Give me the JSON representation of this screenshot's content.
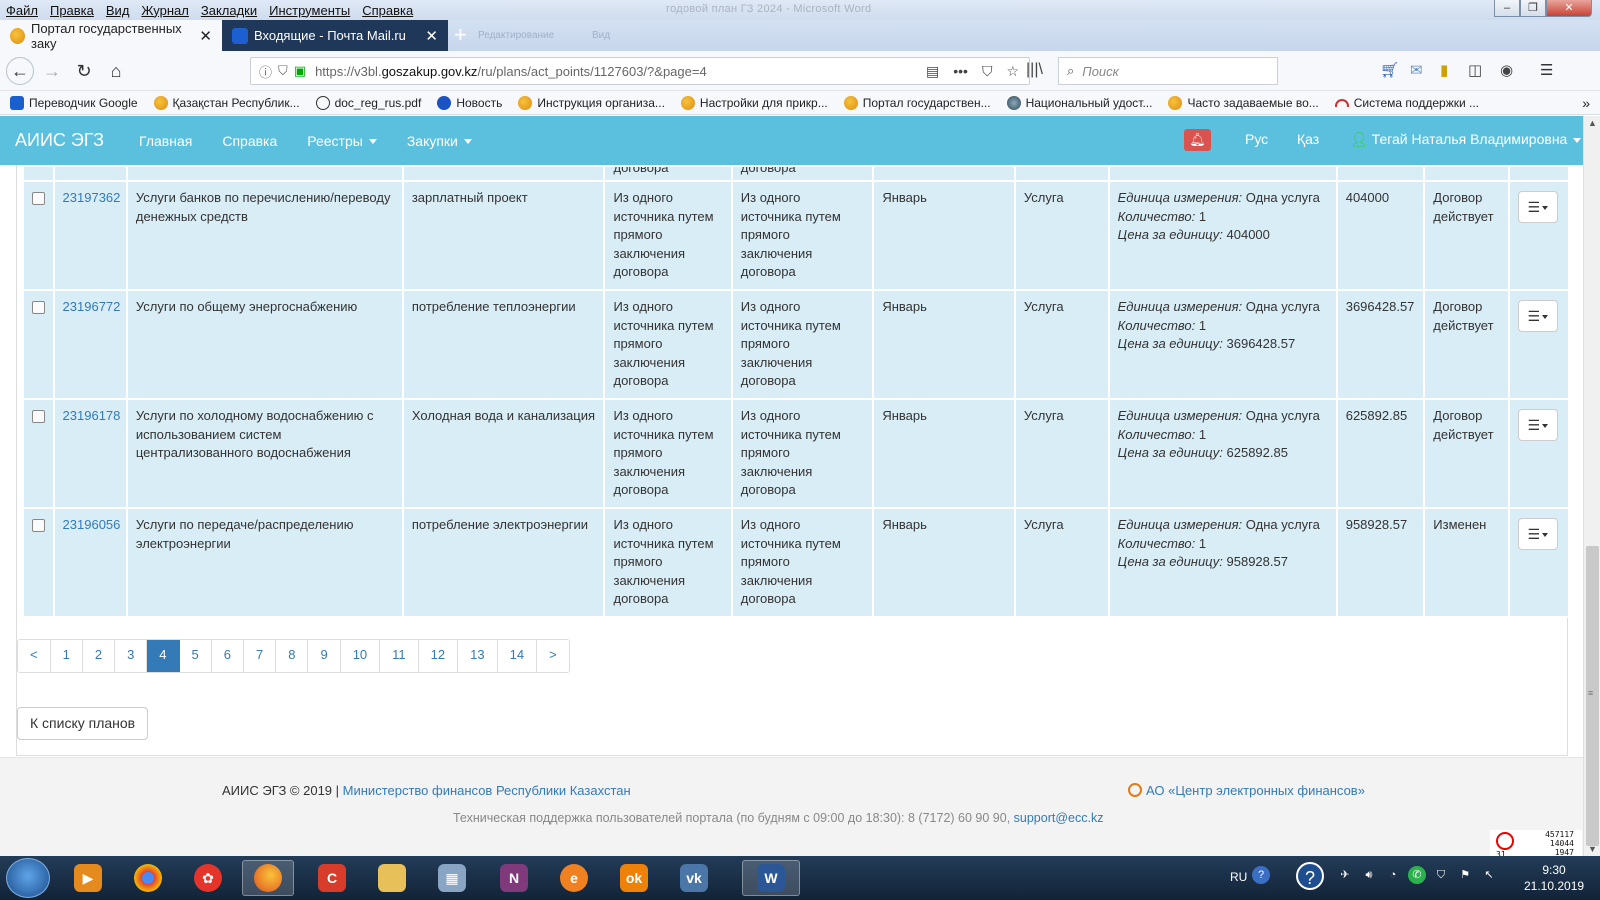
{
  "menubar": {
    "items": [
      "Файл",
      "Правка",
      "Вид",
      "Журнал",
      "Закладки",
      "Инструменты",
      "Справка"
    ],
    "window_title": "годовой план ГЗ 2024 - Microsoft Word"
  },
  "tabs": [
    {
      "label": "Портал государственных заку"
    },
    {
      "label": "Входящие - Почта Mail.ru"
    }
  ],
  "ghost_tabs": [
    "Редактирование",
    "Вид"
  ],
  "nav": {
    "url_host_prefix": "https://v3bl.",
    "url_domain": "goszakup.gov.kz",
    "url_path": "/ru/plans/act_points/1127603/?&page=4",
    "search_placeholder": "Поиск"
  },
  "bookmarks": [
    "Переводчик Google",
    "Қазақстан Республик...",
    "doc_reg_rus.pdf",
    "Новость",
    "Инструкция организа...",
    "Настройки для прикр...",
    "Портал государствен...",
    "Национальный удост...",
    "Часто задаваемые во...",
    "Система поддержки ..."
  ],
  "header": {
    "brand": "АИИС ЭГЗ",
    "nav": [
      "Главная",
      "Справка",
      "Реестры",
      "Закупки"
    ],
    "lang_ru": "Рус",
    "lang_kz": "Қаз",
    "user": "Тегай Наталья Владимировна"
  },
  "cut_row": [
    "договора",
    "договора"
  ],
  "rows": [
    {
      "id": "23197362",
      "name": "Услуги банков по перечислению/переводу денежных средств",
      "desc": "зарплатный проект",
      "method1": "Из одного источника путем прямого заключения договора",
      "method2": "Из одного источника путем прямого заключения договора",
      "month": "Январь",
      "type": "Услуга",
      "unit_label": "Единица измерения:",
      "unit": "Одна услуга",
      "qty_label": "Количество:",
      "qty": "1",
      "price_label": "Цена за единицу:",
      "price": "404000",
      "sum": "404000",
      "status": "Договор действует"
    },
    {
      "id": "23196772",
      "name": "Услуги по общему энергоснабжению",
      "desc": "потребление теплоэнергии",
      "method1": "Из одного источника путем прямого заключения договора",
      "method2": "Из одного источника путем прямого заключения договора",
      "month": "Январь",
      "type": "Услуга",
      "unit_label": "Единица измерения:",
      "unit": "Одна услуга",
      "qty_label": "Количество:",
      "qty": "1",
      "price_label": "Цена за единицу:",
      "price": "3696428.57",
      "sum": "3696428.57",
      "status": "Договор действует"
    },
    {
      "id": "23196178",
      "name": "Услуги по холодному водоснабжению с использованием систем централизованного водоснабжения",
      "desc": "Холодная вода и канализация",
      "method1": "Из одного источника путем прямого заключения договора",
      "method2": "Из одного источника путем прямого заключения договора",
      "month": "Январь",
      "type": "Услуга",
      "unit_label": "Единица измерения:",
      "unit": "Одна услуга",
      "qty_label": "Количество:",
      "qty": "1",
      "price_label": "Цена за единицу:",
      "price": "625892.85",
      "sum": "625892.85",
      "status": "Договор действует"
    },
    {
      "id": "23196056",
      "name": "Услуги по передаче/распределению электроэнергии",
      "desc": "потребление электроэнергии",
      "method1": "Из одного источника путем прямого заключения договора",
      "method2": "Из одного источника путем прямого заключения договора",
      "month": "Январь",
      "type": "Услуга",
      "unit_label": "Единица измерения:",
      "unit": "Одна услуга",
      "qty_label": "Количество:",
      "qty": "1",
      "price_label": "Цена за единицу:",
      "price": "958928.57",
      "sum": "958928.57",
      "status": "Изменен"
    }
  ],
  "pagination": {
    "prev": "<",
    "pages": [
      "1",
      "2",
      "3",
      "4",
      "5",
      "6",
      "7",
      "8",
      "9",
      "10",
      "11",
      "12",
      "13",
      "14"
    ],
    "next": ">",
    "current": "4"
  },
  "back_button": "К списку планов",
  "footer": {
    "copyright": "АИИС ЭГЗ © 2019 |",
    "ministry": "Министерство финансов Республики Казахстан",
    "center": "АО «Центр электронных финансов»",
    "support_text": "Техническая поддержка пользователей портала (по будням с 09:00 до 18:30): 8 (7172) 60 90 90,",
    "support_email": "support@ecc.kz"
  },
  "widget": {
    "line1": "457117",
    "line2": "14044",
    "line3": "1947",
    "small": "31"
  },
  "taskbar": {
    "lang": "RU",
    "time": "9:30",
    "date": "21.10.2019"
  },
  "colors": {
    "header": "#5bc0de",
    "row": "#d9edf7",
    "link": "#337ab7",
    "active_page": "#337ab7",
    "bell": "#d9534f"
  }
}
